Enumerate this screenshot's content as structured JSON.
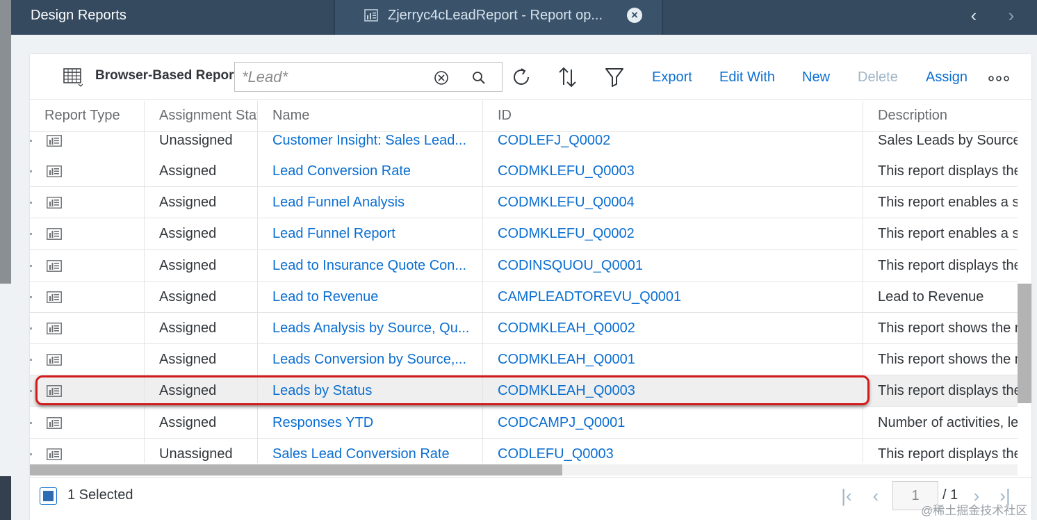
{
  "header": {
    "app_title": "Design Reports",
    "tab": {
      "icon": "report-tab-icon",
      "label": "Zjerryc4cLeadReport - Report op..."
    }
  },
  "toolbar": {
    "title": "Browser-Based Reports",
    "search": {
      "value": "",
      "placeholder": "*Lead*"
    },
    "buttons": {
      "export": "Export",
      "edit_with": "Edit With",
      "new": "New",
      "delete": "Delete",
      "assign": "Assign"
    }
  },
  "table": {
    "columns": [
      "Report Type",
      "Assignment Status",
      "Name",
      "ID",
      "Description"
    ],
    "rows": [
      {
        "status": "Unassigned",
        "name": "Customer Insight: Sales Lead...",
        "id": "CODLEFJ_Q0002",
        "description": "Sales Leads by Source"
      },
      {
        "status": "Assigned",
        "name": "Lead Conversion Rate",
        "id": "CODMKLEFU_Q0003",
        "description": "This report displays the"
      },
      {
        "status": "Assigned",
        "name": "Lead Funnel Analysis",
        "id": "CODMKLEFU_Q0004",
        "description": "This report enables a s"
      },
      {
        "status": "Assigned",
        "name": "Lead Funnel Report",
        "id": "CODMKLEFU_Q0002",
        "description": "This report enables a s"
      },
      {
        "status": "Assigned",
        "name": "Lead to Insurance Quote Con...",
        "id": "CODINSQUOU_Q0001",
        "description": "This report displays the"
      },
      {
        "status": "Assigned",
        "name": "Lead to Revenue",
        "id": "CAMPLEADTOREVU_Q0001",
        "description": "Lead to Revenue"
      },
      {
        "status": "Assigned",
        "name": "Leads Analysis by Source, Qu...",
        "id": "CODMKLEAH_Q0002",
        "description": "This report shows the n"
      },
      {
        "status": "Assigned",
        "name": "Leads Conversion by Source,...",
        "id": "CODMKLEAH_Q0001",
        "description": "This report shows the n"
      },
      {
        "status": "Assigned",
        "name": "Leads by Status",
        "id": "CODMKLEAH_Q0003",
        "description": "This report displays the",
        "selected": true
      },
      {
        "status": "Assigned",
        "name": "Responses YTD",
        "id": "CODCAMPJ_Q0001",
        "description": "Number of activities, le"
      },
      {
        "status": "Unassigned",
        "name": "Sales Lead Conversion Rate",
        "id": "CODLEFU_Q0003",
        "description": "This report displays the"
      }
    ]
  },
  "footer": {
    "selected_count": "1 Selected",
    "page_value": "1",
    "page_total": "/ 1"
  },
  "watermark": "@稀土掘金技术社区",
  "colors": {
    "shell_bar": "#354a5f",
    "link": "#0a6ed1",
    "highlight": "#d11a1a",
    "selected_row": "#efefef"
  }
}
